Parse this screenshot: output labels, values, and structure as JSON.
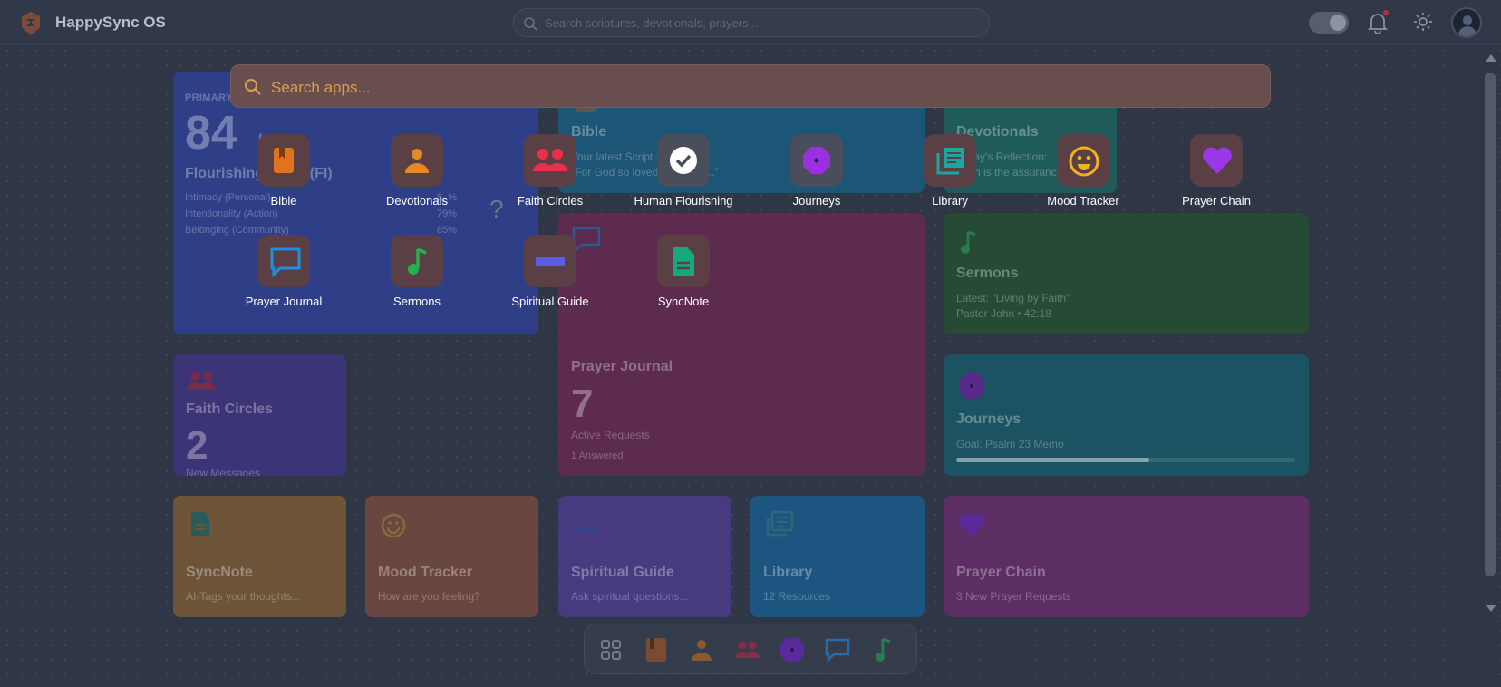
{
  "header": {
    "title": "HappySync OS",
    "search_placeholder": "Search scriptures, devotionals, prayers..."
  },
  "launcher": {
    "search_placeholder": "Search apps...",
    "apps": [
      {
        "label": "Bible",
        "icon": "book-icon",
        "color": "#e0731f"
      },
      {
        "label": "Devotionals",
        "icon": "person-icon",
        "color": "#e48a25"
      },
      {
        "label": "Faith Circles",
        "icon": "group-icon",
        "color": "#e8304c"
      },
      {
        "label": "Human Flourishing",
        "icon": "check-circle-icon",
        "color": "#ffffff"
      },
      {
        "label": "Journeys",
        "icon": "octagon-icon",
        "color": "#9b30e0"
      },
      {
        "label": "Library",
        "icon": "library-icon",
        "color": "#1aa7a1"
      },
      {
        "label": "Mood Tracker",
        "icon": "smile-icon",
        "color": "#f2b21c"
      },
      {
        "label": "Prayer Chain",
        "icon": "heart-icon",
        "color": "#9a38e8"
      },
      {
        "label": "Prayer Journal",
        "icon": "chat-icon",
        "color": "#1e8fe0"
      },
      {
        "label": "Sermons",
        "icon": "music-note-icon",
        "color": "#24b050"
      },
      {
        "label": "Spiritual Guide",
        "icon": "minus-icon",
        "color": "#5a5ce6"
      },
      {
        "label": "SyncNote",
        "icon": "document-icon",
        "color": "#17a97d"
      }
    ]
  },
  "cards": {
    "flourishing": {
      "eyebrow": "PRIMARY METRIC: HUMAN FLOURISHING",
      "score": "84",
      "out_of": "/100",
      "title": "Flourishing Index (FI)",
      "rows": [
        {
          "label": "Intimacy (Personal)",
          "value": "8_%"
        },
        {
          "label": "Intentionality (Action)",
          "value": "79%"
        },
        {
          "label": "Belonging (Community)",
          "value": "85%"
        }
      ],
      "question": "?"
    },
    "bible": {
      "title": "Bible",
      "line1": "Your latest Scripture",
      "line2": "\"For God so loved the world...\""
    },
    "devotionals": {
      "title": "Devotionals",
      "line1": "Today's Reflection:",
      "line2": "Faith is the assurance..."
    },
    "sermons": {
      "title": "Sermons",
      "line1": "Latest: \"Living by Faith\"",
      "line2": "Pastor John • 42:18"
    },
    "prayer_journal": {
      "title": "Prayer Journal",
      "big": "7",
      "line1": "Active Requests",
      "line2": "1 Answered"
    },
    "faith_circles": {
      "title": "Faith Circles",
      "big": "2",
      "line1": "New Messages"
    },
    "journeys": {
      "title": "Journeys",
      "line1": "Goal: Psalm 23 Memo",
      "progress": 0.57
    },
    "syncnote": {
      "title": "SyncNote",
      "line1": "AI-Tags your thoughts..."
    },
    "mood": {
      "title": "Mood Tracker",
      "line1": "How are you feeling?"
    },
    "guide": {
      "title": "Spiritual Guide",
      "line1": "Ask spiritual questions..."
    },
    "library": {
      "title": "Library",
      "line1": "12 Resources"
    },
    "prayer_chain": {
      "title": "Prayer Chain",
      "line1": "3 New Prayer Requests"
    }
  },
  "dock": {
    "items": [
      "grid-icon",
      "book-icon",
      "person-icon",
      "group-icon",
      "octagon-icon",
      "chat-icon",
      "music-note-icon"
    ]
  }
}
